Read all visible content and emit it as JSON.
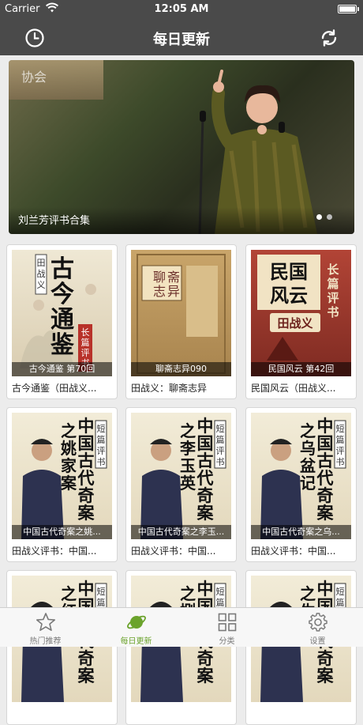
{
  "status": {
    "carrier": "Carrier",
    "time": "12:05 AM"
  },
  "nav": {
    "title": "每日更新"
  },
  "banner": {
    "wall_text": "协会",
    "caption": "刘兰芳评书合集",
    "page_count": 2,
    "active_page": 1
  },
  "cards": [
    {
      "cover_label": "古今通鉴 第70回",
      "name": "古今通鉴（田战义...",
      "cover_title": "古今通鉴",
      "cover_sub": "长篇评书",
      "cover_author": "田战义",
      "style": "ancient"
    },
    {
      "cover_label": "聊斋志异090",
      "name": "田战义：聊斋志异",
      "cover_title": "聊斋志异",
      "cover_sub": "",
      "cover_author": "",
      "style": "scroll"
    },
    {
      "cover_label": "民国风云 第42回",
      "name": "民国风云（田战义...",
      "cover_title": "民国风云",
      "cover_sub": "长篇评书",
      "cover_author": "田战义",
      "style": "red"
    },
    {
      "cover_label": "中国古代奇案之姚...",
      "name": "田战义评书：中国...",
      "cover_title": "中国古代奇案",
      "cover_sub": "短篇评书",
      "cover_author": "之姚家案",
      "style": "portrait"
    },
    {
      "cover_label": "中国古代奇案之李玉...",
      "name": "田战义评书：中国...",
      "cover_title": "中国古代奇案",
      "cover_sub": "短篇评书",
      "cover_author": "之李玉英",
      "style": "portrait"
    },
    {
      "cover_label": "中国古代奇案之乌...",
      "name": "田战义评书：中国...",
      "cover_title": "中国古代奇案",
      "cover_sub": "短篇评书",
      "cover_author": "之乌盆记",
      "style": "portrait"
    },
    {
      "cover_label": "",
      "name": "",
      "cover_title": "中国古代奇案",
      "cover_sub": "短篇评书",
      "cover_author": "之红",
      "style": "portrait"
    },
    {
      "cover_label": "",
      "name": "",
      "cover_title": "中国古代奇案",
      "cover_sub": "短篇评书",
      "cover_author": "之捌",
      "style": "portrait"
    },
    {
      "cover_label": "",
      "name": "",
      "cover_title": "中国古代奇案",
      "cover_sub": "短篇评书",
      "cover_author": "之生",
      "style": "portrait"
    }
  ],
  "tabs": [
    {
      "label": "热门推荐",
      "icon": "star-icon",
      "active": false
    },
    {
      "label": "每日更新",
      "icon": "planet-icon",
      "active": true
    },
    {
      "label": "分类",
      "icon": "grid-icon",
      "active": false
    },
    {
      "label": "设置",
      "icon": "gear-icon",
      "active": false
    }
  ],
  "colors": {
    "nav_bg": "#4a4a4a",
    "active_tab": "#6ba32c",
    "inactive_tab": "#7a7a7a"
  }
}
